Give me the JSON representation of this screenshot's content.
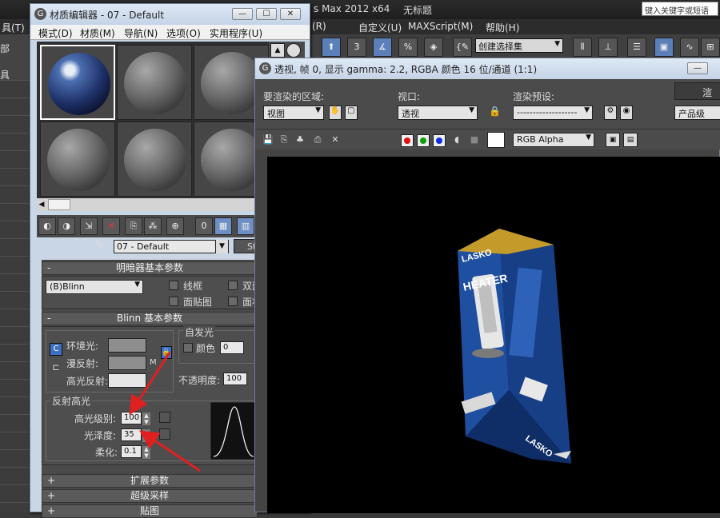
{
  "max": {
    "title_partial": "s Max  2012 x64",
    "doc": "无标题",
    "search_placeholder": "键入关键字或短语",
    "menu": [
      "(R)",
      "自定义(U)",
      "MAXScript(M)",
      "帮助(H)"
    ],
    "menu_left_fragment": "具(T)",
    "selection_set": "创建选择集",
    "left_labels": [
      "部",
      "具"
    ],
    "tool_number": "3",
    "tool_percent": "%"
  },
  "material_editor": {
    "title": "材质编辑器 - 07 - Default",
    "menu": [
      "模式(D)",
      "材质(M)",
      "导航(N)",
      "选项(O)",
      "实用程序(U)"
    ],
    "material_name": "07 - Default",
    "type_button": "St",
    "shader_rollout": "明暗器基本参数",
    "shader_type": "(B)Blinn",
    "checkboxes": [
      "线框",
      "双面",
      "面贴图",
      "面状"
    ],
    "blinn_rollout": "Blinn 基本参数",
    "self_illum_group": "自发光",
    "self_illum_color_label": "颜色",
    "self_illum_value": "0",
    "ambient_label": "环境光:",
    "diffuse_label": "漫反射:",
    "specular_label": "高光反射:",
    "map_button": "M",
    "opacity_label": "不透明度:",
    "opacity_value": "100",
    "highlight_group": "反射高光",
    "spec_level_label": "高光级别:",
    "spec_level_value": "100",
    "gloss_label": "光泽度:",
    "gloss_value": "35",
    "soften_label": "柔化:",
    "soften_value": "0.1",
    "rollouts_collapsed": [
      "扩展参数",
      "超级采样",
      "贴图"
    ],
    "plus": "+",
    "minus": "-"
  },
  "render_window": {
    "title": "透视, 帧 0, 显示 gamma: 2.2, RGBA 颜色 16 位/通道 (1:1)",
    "area_label": "要渲染的区域:",
    "area_value": "视图",
    "viewport_label": "视口:",
    "viewport_value": "透视",
    "preset_label": "渲染预设:",
    "preset_value": "-------------------",
    "render_btn": "渲染",
    "quality_value": "产品级",
    "channel_value": "RGB Alpha"
  },
  "colors": {
    "arrow": "#e02020",
    "box_blue": "#1f4fa0",
    "box_top": "#c49a2a"
  },
  "product_box": {
    "brand": "LASKO",
    "headline": "HEATER",
    "side_brand": "LASKO"
  }
}
